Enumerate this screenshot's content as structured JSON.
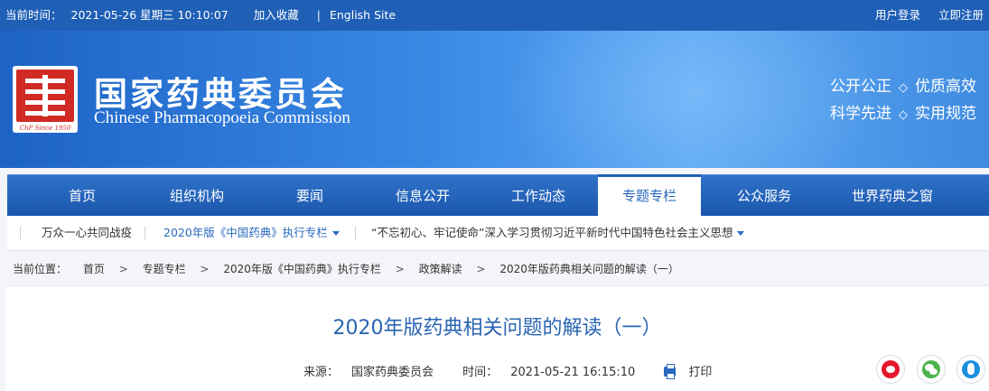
{
  "topbar": {
    "time_label": "当前时间：",
    "datetime": "2021-05-26 星期三 10:10:07",
    "favorite": "加入收藏",
    "separator": "|",
    "english_site": "English Site",
    "login": "用户登录",
    "register": "立即注册"
  },
  "header": {
    "seal_motto": "ChP Since 1950",
    "title_cn": "国家药典委员会",
    "title_en": "Chinese Pharmacopoeia Commission",
    "slogan": {
      "a1": "公开公正",
      "a2": "优质高效",
      "b1": "科学先进",
      "b2": "实用规范",
      "dot": "◇"
    }
  },
  "nav": {
    "items": [
      {
        "label": "首页"
      },
      {
        "label": "组织机构"
      },
      {
        "label": "要闻"
      },
      {
        "label": "信息公开"
      },
      {
        "label": "工作动态"
      },
      {
        "label": "专题专栏"
      },
      {
        "label": "公众服务"
      },
      {
        "label": "世界药典之窗"
      }
    ],
    "active": "专题专栏"
  },
  "subnav": {
    "items": [
      {
        "label": "万众一心共同战疫"
      },
      {
        "label": "2020年版《中国药典》执行专栏"
      },
      {
        "label": "“不忘初心、牢记使命”深入学习贯彻习近平新时代中国特色社会主义思想"
      }
    ]
  },
  "breadcrumb": {
    "label": "当前位置：",
    "separator": ">",
    "items": [
      "首页",
      "专题专栏",
      "2020年版《中国药典》执行专栏",
      "政策解读",
      "2020年版药典相关问题的解读（一）"
    ]
  },
  "article": {
    "title": "2020年版药典相关问题的解读（一）",
    "source_label": "来源：",
    "source": "国家药典委员会",
    "time_label": "时间：",
    "time": "2021-05-21 16:15:10",
    "print": "打印"
  },
  "colors": {
    "brand_blue": "#1f5fb6",
    "link_blue": "#2a69bd",
    "seal_red": "#d12a25"
  }
}
